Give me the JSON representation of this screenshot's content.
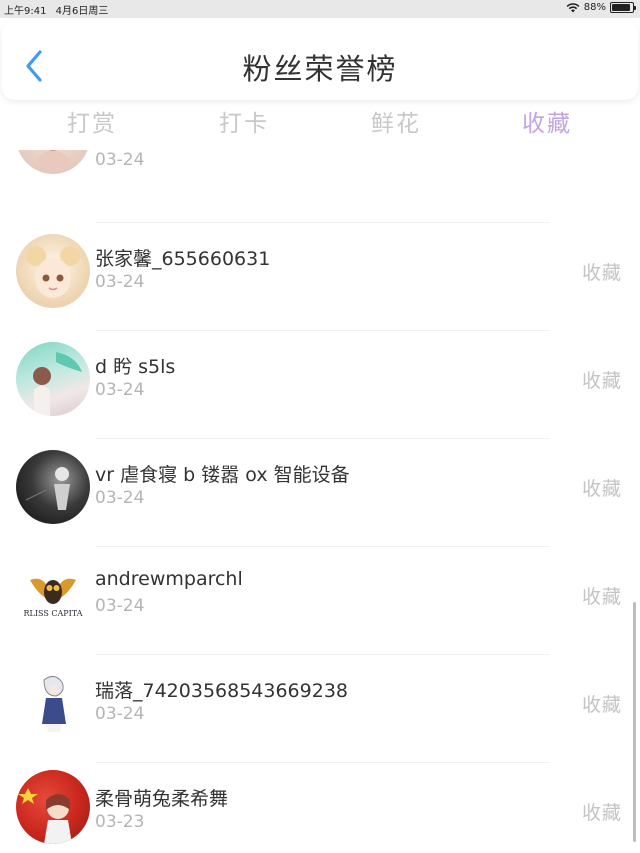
{
  "status_bar": {
    "time": "上午9:41",
    "date": "4月6日周三",
    "battery": "88%",
    "battery_level": 0.88
  },
  "header": {
    "title": "粉丝荣誉榜",
    "back_icon": "chevron-left-icon",
    "accent_color": "#3a9cf5"
  },
  "tabs": [
    {
      "label": "打赏",
      "active": false
    },
    {
      "label": "打卡",
      "active": false
    },
    {
      "label": "鲜花",
      "active": false
    },
    {
      "label": "收藏",
      "active": true
    }
  ],
  "colors": {
    "active_tab": "#c3a3e3",
    "inactive_tab": "#c8c8c8",
    "date_text": "#b5b5b5"
  },
  "fans": [
    {
      "name": "",
      "date": "03-24",
      "action": "收藏"
    },
    {
      "name": "张家馨_655660631",
      "date": "03-24",
      "action": "收藏"
    },
    {
      "name": "d 盻 s5ls",
      "date": "03-24",
      "action": "收藏"
    },
    {
      "name": "vr 虐食寝 b 镂嚣 ox 智能设备",
      "date": "03-24",
      "action": "收藏"
    },
    {
      "name": "andrewmparchl",
      "date": "03-24",
      "action": "收藏",
      "avatar_text": "RLISS CAPITA"
    },
    {
      "name": "瑞落_74203568543669238",
      "date": "03-24",
      "action": "收藏"
    },
    {
      "name": "柔骨萌兔柔希舞",
      "date": "03-23",
      "action": "收藏"
    }
  ]
}
